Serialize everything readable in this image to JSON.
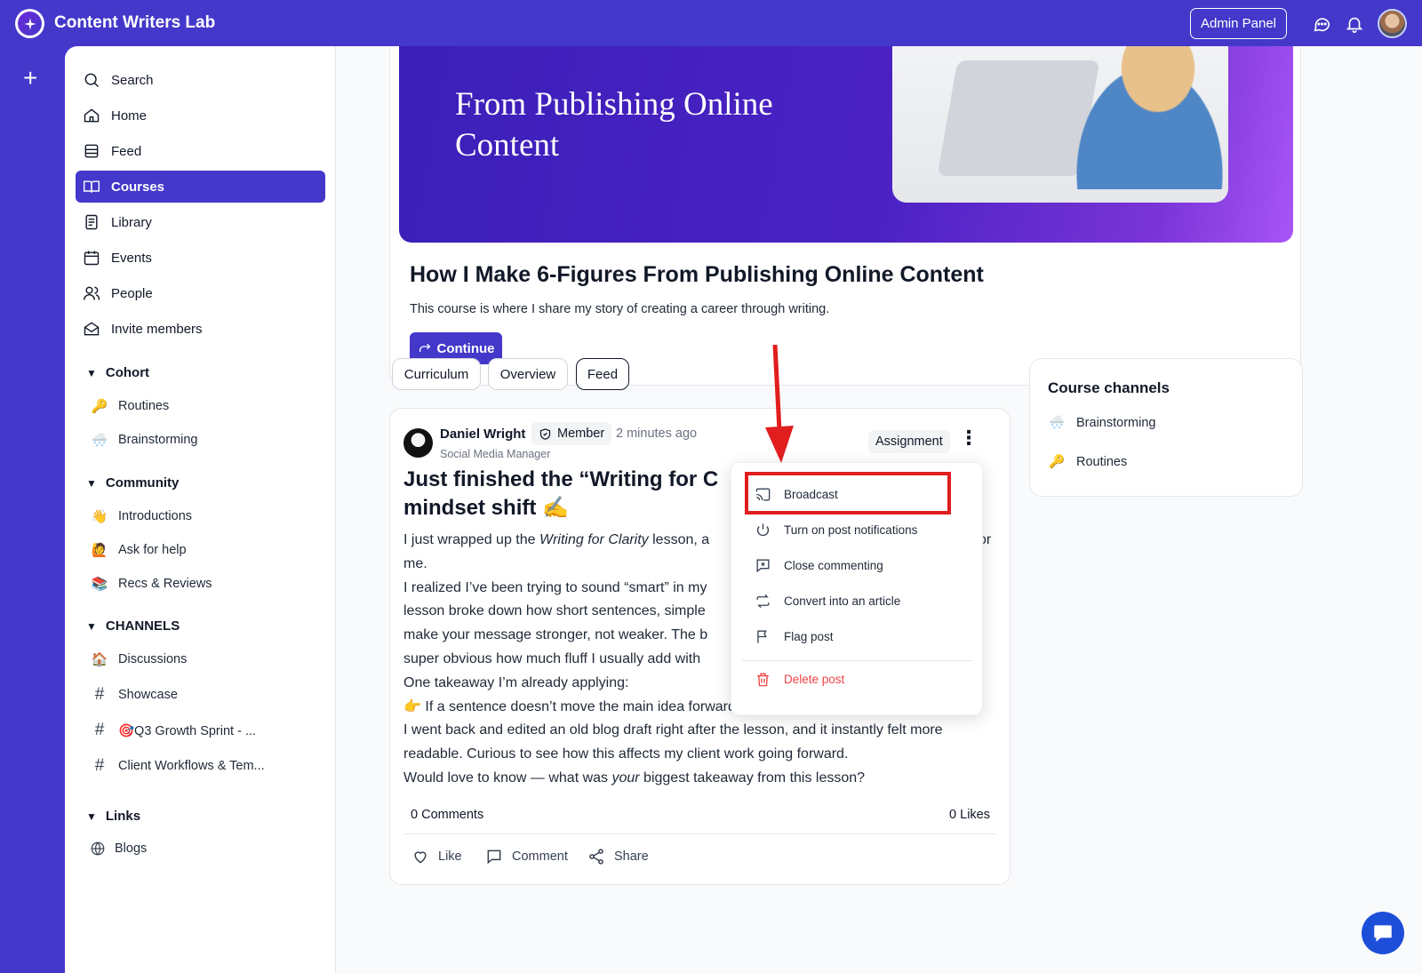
{
  "app": {
    "title": "Content Writers Lab",
    "admin_label": "Admin Panel"
  },
  "colors": {
    "brand": "#4338ca",
    "danger": "#ef4444",
    "highlight": "#e11d1d"
  },
  "sidebar": {
    "nav": [
      {
        "label": "Search",
        "icon": "search-icon"
      },
      {
        "label": "Home",
        "icon": "home-icon"
      },
      {
        "label": "Feed",
        "icon": "feed-icon"
      },
      {
        "label": "Courses",
        "icon": "book-icon",
        "active": true
      },
      {
        "label": "Library",
        "icon": "library-icon"
      },
      {
        "label": "Events",
        "icon": "calendar-icon"
      },
      {
        "label": "People",
        "icon": "people-icon"
      },
      {
        "label": "Invite members",
        "icon": "envelope-icon"
      }
    ],
    "sections": {
      "cohort": {
        "title": "Cohort",
        "items": [
          {
            "emoji": "🔑",
            "label": "Routines"
          },
          {
            "emoji": "🌨️",
            "label": "Brainstorming"
          }
        ]
      },
      "community": {
        "title": "Community",
        "items": [
          {
            "emoji": "👋",
            "label": "Introductions"
          },
          {
            "emoji": "🙋",
            "label": "Ask for help"
          },
          {
            "emoji": "📚",
            "label": "Recs & Reviews"
          }
        ]
      },
      "channels": {
        "title": "CHANNELS",
        "items": [
          {
            "emoji": "🏠",
            "label": "Discussions"
          },
          {
            "emoji": "#",
            "label": "Showcase"
          },
          {
            "emoji": "#",
            "label": "🎯Q3 Growth Sprint - ..."
          },
          {
            "emoji": "#",
            "label": "Client Workflows & Tem..."
          }
        ]
      },
      "links": {
        "title": "Links",
        "items": [
          {
            "icon": "globe-icon",
            "label": "Blogs"
          }
        ]
      }
    }
  },
  "course": {
    "hero_text": "From Publishing Online Content",
    "title": "How I Make 6-Figures From Publishing Online Content",
    "description": "This course is where I share my story of creating a career through writing.",
    "continue_label": "Continue",
    "tabs": [
      "Curriculum",
      "Overview",
      "Feed"
    ],
    "active_tab": "Feed"
  },
  "post": {
    "author": "Daniel Wright",
    "badge": "Member",
    "time": "2 minutes ago",
    "role": "Social Media Manager",
    "tag": "Assignment",
    "title": "Just finished the “Writing for C",
    "title_line2": "mindset shift ✍️",
    "body": [
      "I just wrapped up the ",
      "Writing for Clarity",
      " lesson, a",
      "me.",
      "I realized I’ve been trying to sound “smart” in my",
      "lesson broke down how short sentences, simple",
      "make your message stronger, not weaker. The b",
      "super obvious how much fluff I usually add with",
      "One takeaway I’m already applying:",
      "👉 If a sentence doesn’t move the main idea forward, it probably doesn’t belong.",
      "I went back and edited an old blog draft right after the lesson, and it instantly felt more",
      "readable. Curious to see how this affects my client work going forward.",
      "Would love to know — what was ",
      "your",
      " biggest takeaway from this lesson?"
    ],
    "body_tail": "or",
    "comments": "0 Comments",
    "likes": "0 Likes",
    "actions": [
      "Like",
      "Comment",
      "Share"
    ]
  },
  "menu": {
    "items": [
      {
        "label": "Broadcast",
        "icon": "cast-icon"
      },
      {
        "label": "Turn on post notifications",
        "icon": "power-icon"
      },
      {
        "label": "Close commenting",
        "icon": "close-comment-icon"
      },
      {
        "label": "Convert into an article",
        "icon": "convert-icon"
      },
      {
        "label": "Flag post",
        "icon": "flag-icon"
      }
    ],
    "danger_item": {
      "label": "Delete post",
      "icon": "trash-icon"
    }
  },
  "channels_card": {
    "title": "Course channels",
    "items": [
      {
        "emoji": "🌨️",
        "label": "Brainstorming"
      },
      {
        "emoji": "🔑",
        "label": "Routines"
      }
    ]
  }
}
